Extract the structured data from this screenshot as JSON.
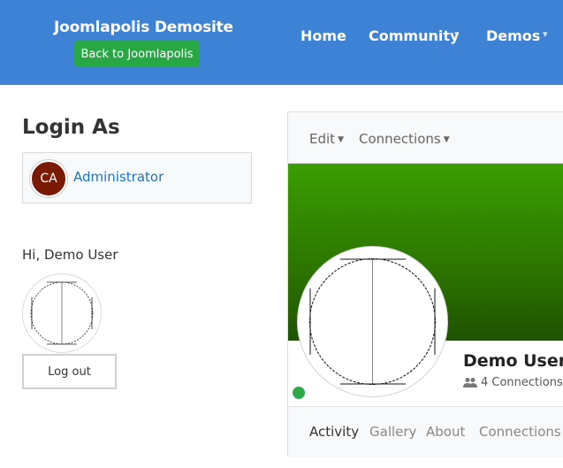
{
  "header": {
    "brand": "Joomlapolis Demosite",
    "back_button": "Back to Joomlapolis",
    "nav": [
      {
        "label": "Home",
        "has_dropdown": false
      },
      {
        "label": "Community",
        "has_dropdown": true
      },
      {
        "label": "Demos",
        "has_dropdown": true
      }
    ],
    "bg_color": "#3d82d4",
    "button_color": "#28a745"
  },
  "login_as": {
    "title": "Login As",
    "admin_initials": "CA",
    "admin_name": "Administrator"
  },
  "user_box": {
    "greeting": "Hi, Demo User",
    "logout_label": "Log out"
  },
  "profile": {
    "toolbar": [
      {
        "label": "Edit",
        "icon": "caret-down-icon"
      },
      {
        "label": "Connections",
        "icon": "caret-down-icon"
      }
    ],
    "name": "Demo User",
    "connections": "4 Connections",
    "connections_icon": "users-icon",
    "status": "online",
    "cover_color": "#3a9e00",
    "tabs": [
      {
        "label": "Activity",
        "active": true
      },
      {
        "label": "Gallery",
        "active": false
      },
      {
        "label": "About",
        "active": false
      },
      {
        "label": "Connections",
        "active": false
      }
    ]
  }
}
